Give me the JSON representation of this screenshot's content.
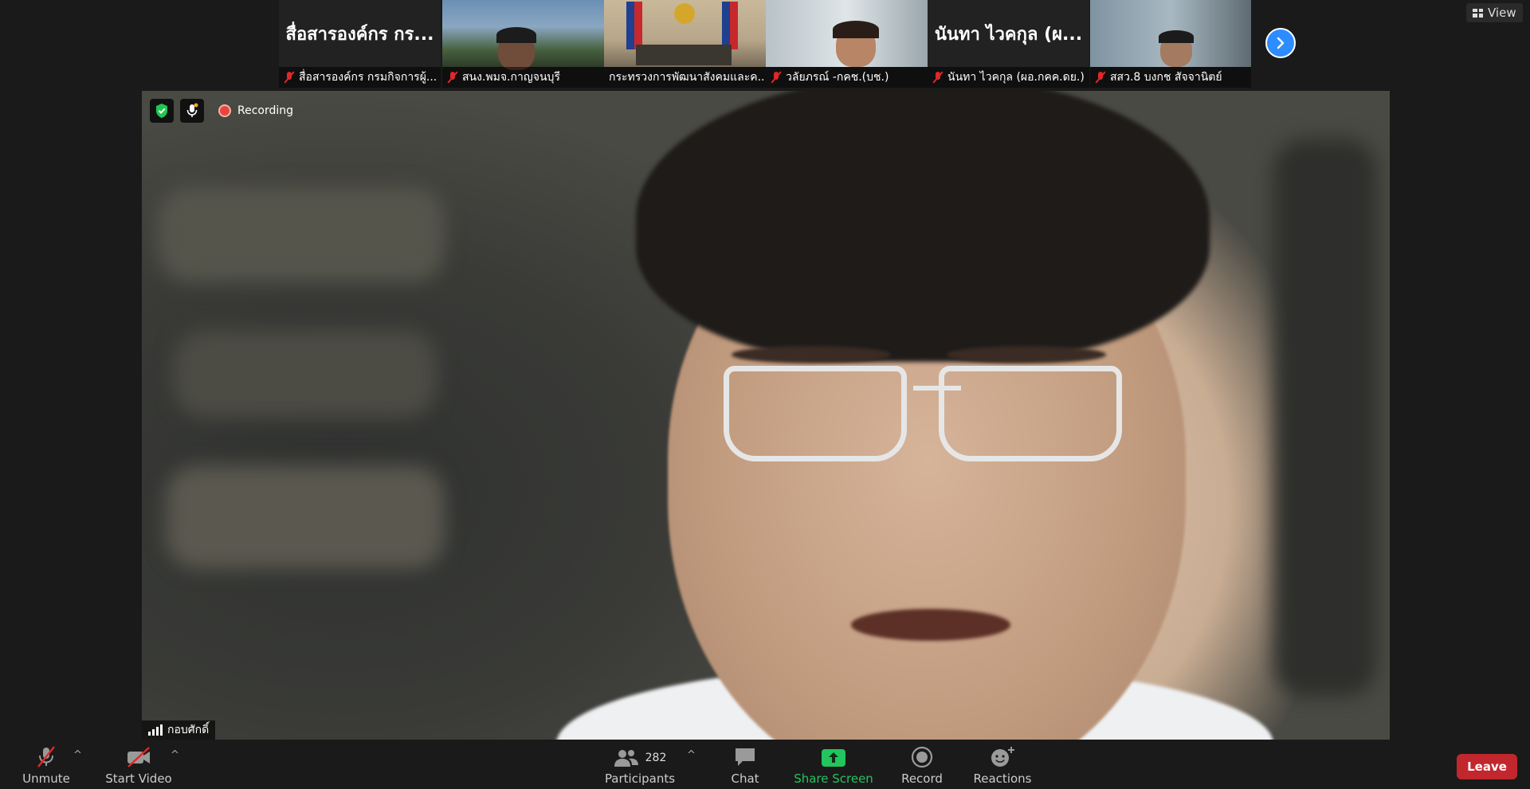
{
  "thumbnails": [
    {
      "title": "สื่อสารองค์กร กร...",
      "caption": "สื่อสารองค์กร กรมกิจการผู้...",
      "type": "name"
    },
    {
      "title": "",
      "caption": "สนง.พมจ.กาญจนบุรี",
      "type": "video"
    },
    {
      "title": "",
      "caption": "กระทรวงการพัฒนาสังคมและค...",
      "type": "video"
    },
    {
      "title": "",
      "caption": "วลัยภรณ์ -กคช.(บช.)",
      "type": "video"
    },
    {
      "title": "นันทา ไวคกุล (ผ...",
      "caption": "นันทา ไวคกุล (ผอ.กคค.ดย.)",
      "type": "name"
    },
    {
      "title": "",
      "caption": "สสว.8 บงกช สัจจานิตย์",
      "type": "video"
    }
  ],
  "view_label": "View",
  "recording_label": "Recording",
  "speaker_name": "กอบศักดิ์",
  "toolbar": {
    "unmute": "Unmute",
    "start_video": "Start Video",
    "participants": "Participants",
    "participants_count": "282",
    "chat": "Chat",
    "share_screen": "Share Screen",
    "record": "Record",
    "reactions": "Reactions",
    "leave": "Leave"
  },
  "colors": {
    "accent_blue": "#2d8cff",
    "share_green": "#22c55e",
    "leave_red": "#c1272d",
    "muted_red": "#e02828"
  }
}
